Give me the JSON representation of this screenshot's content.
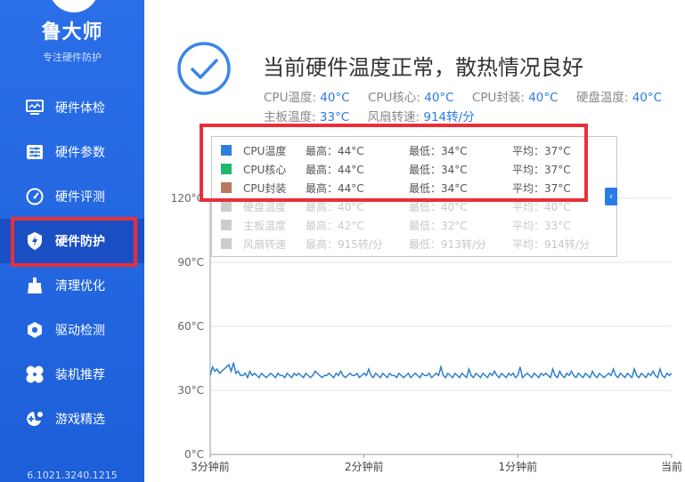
{
  "sidebar": {
    "brand": "鲁大师",
    "subtitle": "专注硬件防护",
    "items": [
      {
        "label": "硬件体检",
        "icon": "monitor-icon"
      },
      {
        "label": "硬件参数",
        "icon": "sliders-icon"
      },
      {
        "label": "硬件评测",
        "icon": "speedometer-icon"
      },
      {
        "label": "硬件防护",
        "icon": "shield-bolt-icon",
        "active": true
      },
      {
        "label": "清理优化",
        "icon": "broom-icon"
      },
      {
        "label": "驱动检测",
        "icon": "hexagon-gear-icon"
      },
      {
        "label": "装机推荐",
        "icon": "clover-icon"
      },
      {
        "label": "游戏精选",
        "icon": "gamepad-icon"
      }
    ],
    "version": "6.1021.3240.1215"
  },
  "status": {
    "headline": "当前硬件温度正常，散热情况良好",
    "items": [
      {
        "label": "CPU温度:",
        "value": "40°C"
      },
      {
        "label": "CPU核心:",
        "value": "40°C"
      },
      {
        "label": "CPU封装:",
        "value": "40°C"
      },
      {
        "label": "硬盘温度:",
        "value": "40°C"
      },
      {
        "label": "主板温度:",
        "value": "33°C"
      },
      {
        "label": "风扇转速:",
        "value": "914转/分"
      }
    ]
  },
  "legend": {
    "rows": [
      {
        "name": "CPU温度",
        "max": "最高：44°C",
        "min": "最低：34°C",
        "avg": "平均：37°C",
        "color": "#2f7de1",
        "enabled": true
      },
      {
        "name": "CPU核心",
        "max": "最高：44°C",
        "min": "最低：34°C",
        "avg": "平均：37°C",
        "color": "#1fb86a",
        "enabled": true
      },
      {
        "name": "CPU封装",
        "max": "最高：44°C",
        "min": "最低：34°C",
        "avg": "平均：37°C",
        "color": "#b9785a",
        "enabled": true
      },
      {
        "name": "硬盘温度",
        "max": "最高：40°C",
        "min": "最低：40°C",
        "avg": "平均：40°C",
        "color": "#cccccc",
        "enabled": false
      },
      {
        "name": "主板温度",
        "max": "最高：42°C",
        "min": "最低：32°C",
        "avg": "平均：33°C",
        "color": "#cccccc",
        "enabled": false
      },
      {
        "name": "风扇转速",
        "max": "最高：915转/分",
        "min": "最低：913转/分",
        "avg": "平均：914转/分",
        "color": "#cccccc",
        "enabled": false
      }
    ],
    "collapse_glyph": "‹"
  },
  "chart_data": {
    "type": "line",
    "y_ticks": [
      "0°C",
      "30°C",
      "60°C",
      "90°C",
      "120°C"
    ],
    "ylim": [
      0,
      120
    ],
    "x_ticks": [
      "3分钟前",
      "2分钟前",
      "1分钟前",
      "当前"
    ],
    "series": [
      {
        "name": "CPU温度",
        "color": "#2f7de1",
        "values": [
          37,
          41,
          39,
          40,
          38,
          39,
          40,
          41,
          42,
          39,
          43,
          38,
          39,
          37,
          37,
          38,
          36,
          39,
          37,
          38,
          37,
          36,
          38,
          37,
          36,
          37,
          38,
          37,
          36,
          38,
          37,
          37,
          36,
          38,
          37,
          36,
          38,
          37,
          38,
          37,
          36,
          38,
          37,
          36,
          37,
          39,
          38,
          37,
          36,
          37,
          37,
          38,
          37,
          36,
          38,
          37,
          39,
          37,
          36,
          37,
          38,
          37,
          37,
          38,
          36,
          37,
          38,
          37,
          40,
          37,
          36,
          38,
          37,
          36,
          38,
          37,
          36,
          38,
          37,
          37,
          36,
          38,
          37,
          36,
          37,
          38,
          36,
          37,
          38,
          37,
          36,
          38,
          37,
          37,
          38,
          36,
          37,
          38,
          37,
          41,
          37,
          36,
          38,
          37,
          36,
          38,
          37,
          36,
          38,
          37,
          36,
          40,
          37,
          36,
          38,
          37,
          36,
          38,
          37,
          36,
          38,
          37,
          39,
          37,
          36,
          38,
          37,
          36,
          38,
          37,
          38,
          36,
          37,
          41,
          36,
          37,
          38,
          37,
          36,
          38,
          37,
          36,
          38,
          37,
          38,
          37,
          36,
          40,
          37,
          36,
          39,
          37,
          36,
          38,
          37,
          39,
          37,
          36,
          38,
          37,
          36,
          38,
          37,
          36,
          39,
          37,
          36,
          38,
          37,
          36,
          37,
          38,
          37,
          40,
          37,
          36,
          38,
          37,
          36,
          38,
          37,
          36,
          40,
          37,
          36,
          38,
          37,
          36,
          38,
          37,
          39,
          37,
          36,
          40,
          37,
          36,
          38,
          37,
          38
        ]
      },
      {
        "name": "CPU核心",
        "color": "#1fb86a",
        "values": [
          37,
          41,
          39,
          40,
          38,
          39,
          40,
          41,
          42,
          39,
          43,
          38,
          39,
          37,
          37,
          38,
          36,
          39,
          37,
          38,
          37,
          36,
          38,
          37,
          36,
          37,
          38,
          37,
          36,
          38,
          37,
          37,
          36,
          38,
          37,
          36,
          38,
          37,
          38,
          37,
          36,
          38,
          37,
          36,
          37,
          39,
          38,
          37,
          36,
          37,
          37,
          38,
          37,
          36,
          38,
          37,
          39,
          37,
          36,
          37,
          38,
          37,
          37,
          38,
          36,
          37,
          38,
          37,
          40,
          37,
          36,
          38,
          37,
          36,
          38,
          37,
          36,
          38,
          37,
          37,
          36,
          38,
          37,
          36,
          37,
          38,
          36,
          37,
          38,
          37,
          36,
          38,
          37,
          37,
          38,
          36,
          37,
          38,
          37,
          41,
          37,
          36,
          38,
          37,
          36,
          38,
          37,
          36,
          38,
          37,
          36,
          40,
          37,
          36,
          38,
          37,
          36,
          38,
          37,
          36,
          38,
          37,
          39,
          37,
          36,
          38,
          37,
          36,
          38,
          37,
          38,
          36,
          37,
          41,
          36,
          37,
          38,
          37,
          36,
          38,
          37,
          36,
          38,
          37,
          38,
          37,
          36,
          40,
          37,
          36,
          39,
          37,
          36,
          38,
          37,
          39,
          37,
          36,
          38,
          37,
          36,
          38,
          37,
          36,
          39,
          37,
          36,
          38,
          37,
          36,
          37,
          38,
          37,
          40,
          37,
          36,
          38,
          37,
          36,
          38,
          37,
          36,
          40,
          37,
          36,
          38,
          37,
          36,
          38,
          37,
          39,
          37,
          36,
          40,
          37,
          36,
          38,
          37,
          38
        ]
      },
      {
        "name": "CPU封装",
        "color": "#b9785a",
        "values": [
          37,
          41,
          39,
          40,
          38,
          39,
          40,
          41,
          42,
          39,
          43,
          38,
          39,
          37,
          37,
          38,
          36,
          39,
          37,
          38,
          37,
          36,
          38,
          37,
          36,
          37,
          38,
          37,
          36,
          38,
          37,
          37,
          36,
          38,
          37,
          36,
          38,
          37,
          38,
          37,
          36,
          38,
          37,
          36,
          37,
          39,
          38,
          37,
          36,
          37,
          37,
          38,
          37,
          36,
          38,
          37,
          39,
          37,
          36,
          37,
          38,
          37,
          37,
          38,
          36,
          37,
          38,
          37,
          40,
          37,
          36,
          38,
          37,
          36,
          38,
          37,
          36,
          38,
          37,
          37,
          36,
          38,
          37,
          36,
          37,
          38,
          36,
          37,
          38,
          37,
          36,
          38,
          37,
          37,
          38,
          36,
          37,
          38,
          37,
          41,
          37,
          36,
          38,
          37,
          36,
          38,
          37,
          36,
          38,
          37,
          36,
          40,
          37,
          36,
          38,
          37,
          36,
          38,
          37,
          36,
          38,
          37,
          39,
          37,
          36,
          38,
          37,
          36,
          38,
          37,
          38,
          36,
          37,
          41,
          36,
          37,
          38,
          37,
          36,
          38,
          37,
          36,
          38,
          37,
          38,
          37,
          36,
          40,
          37,
          36,
          39,
          37,
          36,
          38,
          37,
          39,
          37,
          36,
          38,
          37,
          36,
          38,
          37,
          36,
          39,
          37,
          36,
          38,
          37,
          36,
          37,
          38,
          37,
          40,
          37,
          36,
          38,
          37,
          36,
          38,
          37,
          36,
          40,
          37,
          36,
          38,
          37,
          36,
          38,
          37,
          39,
          37,
          36,
          40,
          37,
          36,
          38,
          37,
          38
        ]
      }
    ],
    "grid": true
  }
}
